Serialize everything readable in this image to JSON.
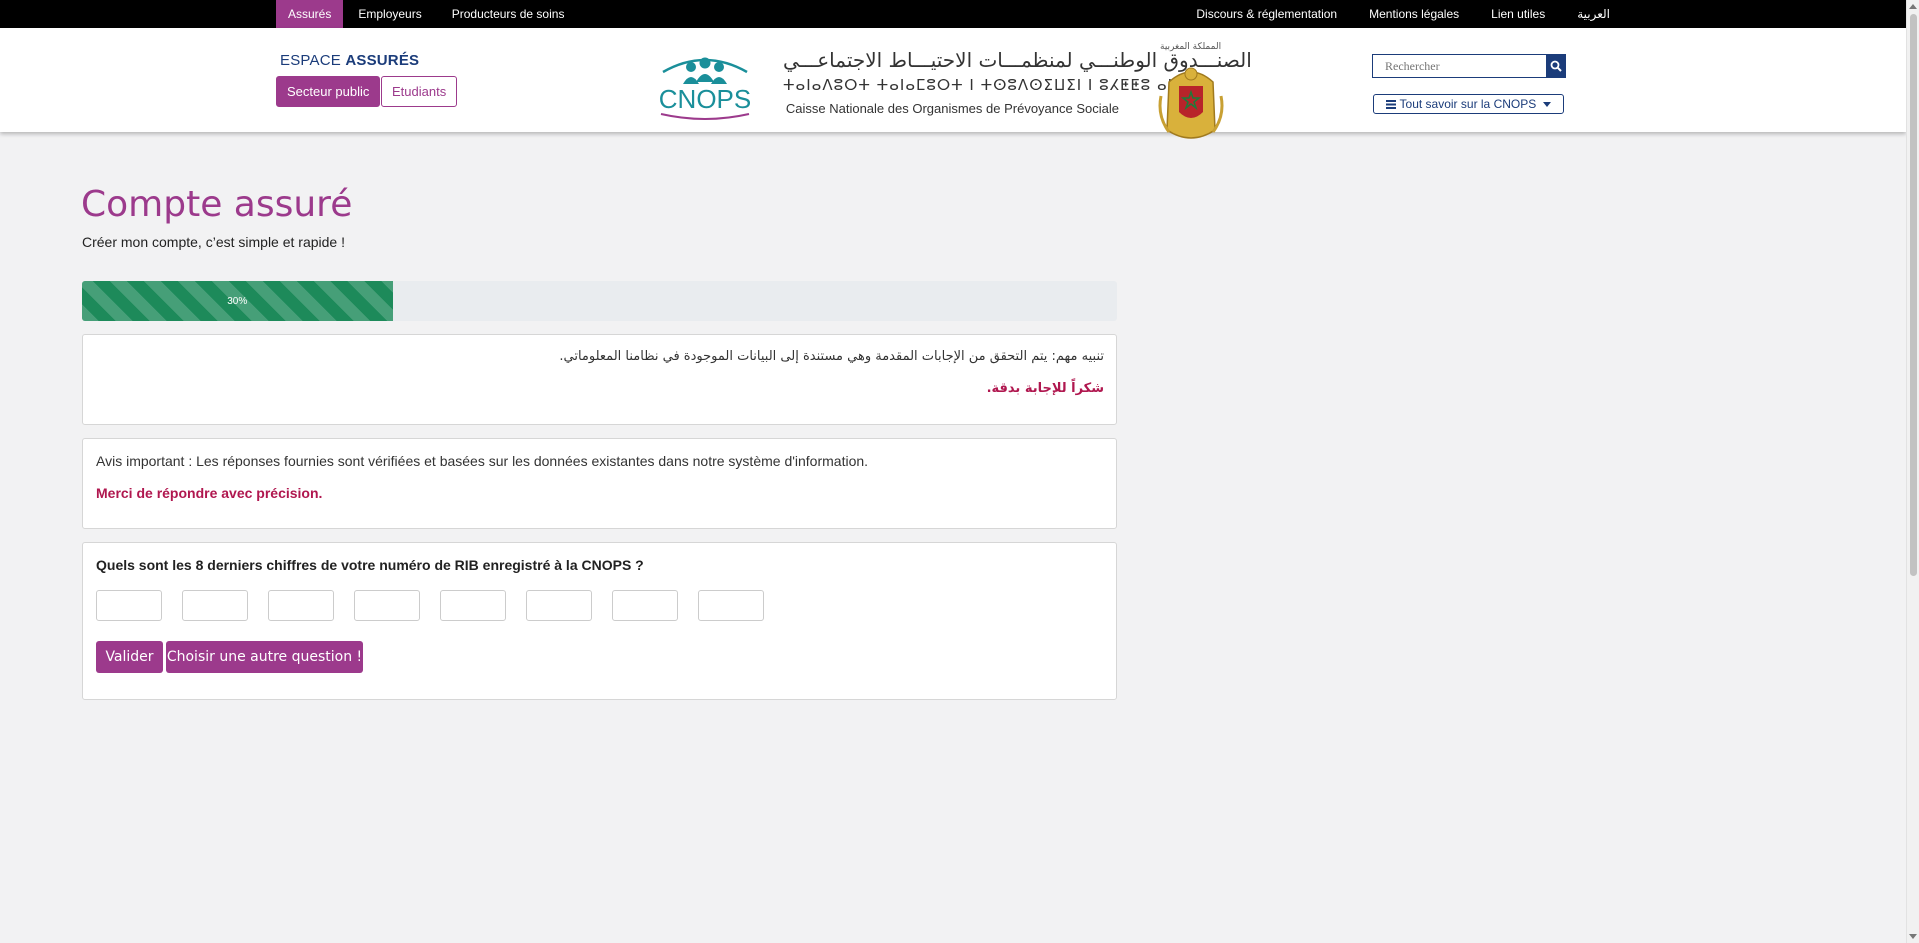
{
  "topnav": {
    "left": [
      {
        "label": "Assurés",
        "active": true
      },
      {
        "label": "Employeurs"
      },
      {
        "label": "Producteurs de soins"
      }
    ],
    "right": [
      {
        "label": "Discours & réglementation"
      },
      {
        "label": "Mentions légales"
      },
      {
        "label": "Lien utiles"
      },
      {
        "label": "العربية"
      }
    ]
  },
  "header": {
    "espace_prefix": "ESPACE",
    "espace_strong": "ASSURÉS",
    "btn_public": "Secteur public",
    "btn_etudiants": "Etudiants",
    "logo_text": "CNOPS",
    "org_ar": "الصنـــدوق الوطنـــي لمنظمـــات الاحتيـــاط الاجتماعـــي",
    "org_tifinagh": "ⵜⴰⵏⴰⴷⵓⵔⵜ ⵜⴰⵏⴰⵎⵓⵔⵜ ⵏ ⵜⵙⵓⴷⵙⵉⵡⵉⵏ ⵏ ⵓⵃⵟⵟⵓ ⴰⵏⴰⵎⵓⵏ",
    "org_fr": "Caisse Nationale des Organismes de Prévoyance Sociale",
    "kingdom_label": "المملكة المغربية",
    "search_placeholder": "Rechercher",
    "tout_savoir": "Tout savoir sur la CNOPS"
  },
  "main": {
    "title": "Compte assuré",
    "subtitle": "Créer mon compte, c’est simple et rapide !",
    "progress_value": 30,
    "progress_label": "30%",
    "notice_ar": "تنبيه مهم: يتم التحقق من الإجابات المقدمة وهي مستندة إلى البيانات الموجودة في نظامنا المعلوماتي.",
    "thanks_ar": "شكراً للإجابة بدقة.",
    "notice_fr": "Avis important : Les réponses fournies sont vérifiées et basées sur les données existantes dans notre système d'information.",
    "thanks_fr": "Merci de répondre avec précision.",
    "question": "Quels sont les 8 derniers chiffres de votre numéro de RIB enregistré à la CNOPS ?",
    "digit_count": 8,
    "btn_valider": "Valider",
    "btn_autre": "Choisir une autre question !"
  },
  "colors": {
    "brand_purple": "#9c3a8c",
    "brand_blue": "#1b3c7a",
    "progress_green": "#1d8a5a",
    "alert_red": "#b0174f"
  },
  "icons": {
    "search": "search-icon",
    "menu": "hamburger-icon",
    "caret": "caret-down-icon"
  }
}
